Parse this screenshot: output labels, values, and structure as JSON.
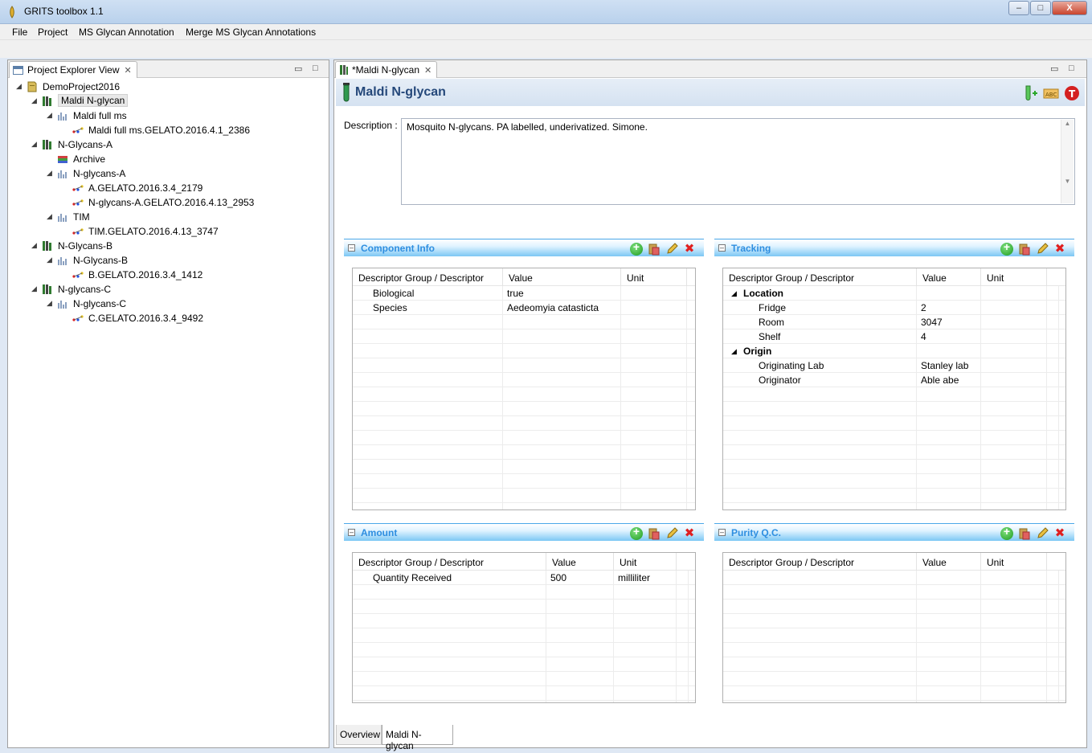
{
  "window": {
    "title": "GRITS toolbox 1.1",
    "min": "–",
    "max": "□",
    "close": "X"
  },
  "menu": [
    "File",
    "Project",
    "MS Glycan Annotation",
    "Merge MS Glycan Annotations"
  ],
  "left": {
    "tab": "Project Explorer View",
    "tree": [
      {
        "label": "DemoProject2016",
        "icon": "folder-icon"
      },
      {
        "label": "Maldi N-glycan",
        "icon": "sample-icon"
      },
      {
        "label": "Maldi full ms",
        "icon": "ms-chart-icon"
      },
      {
        "label": "Maldi full ms.GELATO.2016.4.1_2386",
        "icon": "annotation-icon"
      },
      {
        "label": "N-Glycans-A",
        "icon": "sample-icon"
      },
      {
        "label": "Archive",
        "icon": "archive-icon"
      },
      {
        "label": "N-glycans-A",
        "icon": "ms-chart-icon"
      },
      {
        "label": "A.GELATO.2016.3.4_2179",
        "icon": "annotation-icon"
      },
      {
        "label": "N-glycans-A.GELATO.2016.4.13_2953",
        "icon": "annotation-icon"
      },
      {
        "label": "TIM",
        "icon": "ms-chart-icon"
      },
      {
        "label": "TIM.GELATO.2016.4.13_3747",
        "icon": "annotation-icon"
      },
      {
        "label": "N-Glycans-B",
        "icon": "sample-icon"
      },
      {
        "label": "N-Glycans-B",
        "icon": "ms-chart-icon"
      },
      {
        "label": "B.GELATO.2016.3.4_1412",
        "icon": "annotation-icon"
      },
      {
        "label": "N-glycans-C",
        "icon": "sample-icon"
      },
      {
        "label": "N-glycans-C",
        "icon": "ms-chart-icon"
      },
      {
        "label": "C.GELATO.2016.3.4_9492",
        "icon": "annotation-icon"
      }
    ]
  },
  "editor": {
    "tab": "*Maldi N-glycan",
    "title": "Maldi N-glycan",
    "description_label": "Description :",
    "description": "Mosquito N-glycans.  PA labelled, underivatized. Simone.",
    "bottom_tabs": [
      "Overview",
      "Maldi N-glycan"
    ]
  },
  "columns": {
    "descriptor": "Descriptor Group / Descriptor",
    "value": "Value",
    "unit": "Unit"
  },
  "sections": {
    "component": {
      "title": "Component Info",
      "rows": [
        {
          "d": "Biological",
          "v": "true",
          "u": ""
        },
        {
          "d": "Species",
          "v": "Aedeomyia catasticta",
          "u": ""
        }
      ]
    },
    "tracking": {
      "title": "Tracking",
      "rows": [
        {
          "d": "Location",
          "v": "",
          "u": "",
          "group": true
        },
        {
          "d": "Fridge",
          "v": "2",
          "u": ""
        },
        {
          "d": "Room",
          "v": "3047",
          "u": ""
        },
        {
          "d": "Shelf",
          "v": "4",
          "u": ""
        },
        {
          "d": "Origin",
          "v": "",
          "u": "",
          "group": true
        },
        {
          "d": "Originating Lab",
          "v": "Stanley lab",
          "u": ""
        },
        {
          "d": "Originator",
          "v": "Able abe",
          "u": ""
        }
      ]
    },
    "amount": {
      "title": "Amount",
      "rows": [
        {
          "d": "Quantity Received",
          "v": "500",
          "u": "milliliter"
        }
      ]
    },
    "purity": {
      "title": "Purity Q.C.",
      "rows": []
    }
  }
}
